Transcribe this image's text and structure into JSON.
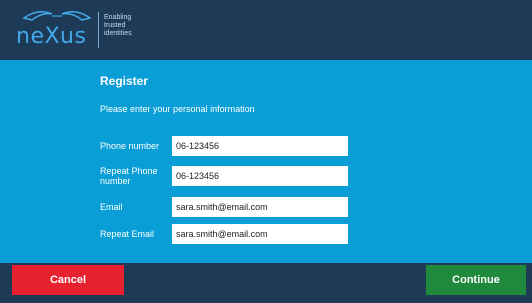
{
  "header": {
    "logo_text": "neXus",
    "tagline_lines": [
      "Enabling",
      "trusted",
      "identities"
    ]
  },
  "form": {
    "title": "Register",
    "subtitle": "Please enter your personal information",
    "fields": [
      {
        "label": "Phone number",
        "value": "06-123456"
      },
      {
        "label": "Repeat Phone number",
        "value": "06-123456"
      },
      {
        "label": "Email",
        "value": "sara.smith@email.com"
      },
      {
        "label": "Repeat Email",
        "value": "sara.smith@email.com"
      }
    ]
  },
  "buttons": {
    "cancel_label": "Cancel",
    "continue_label": "Continue"
  },
  "colors": {
    "header_bg": "#1d3a57",
    "panel_bg": "#0a9ed6",
    "cancel_bg": "#e8212f",
    "continue_bg": "#1f8a3b",
    "logo_accent": "#43a8e8"
  }
}
